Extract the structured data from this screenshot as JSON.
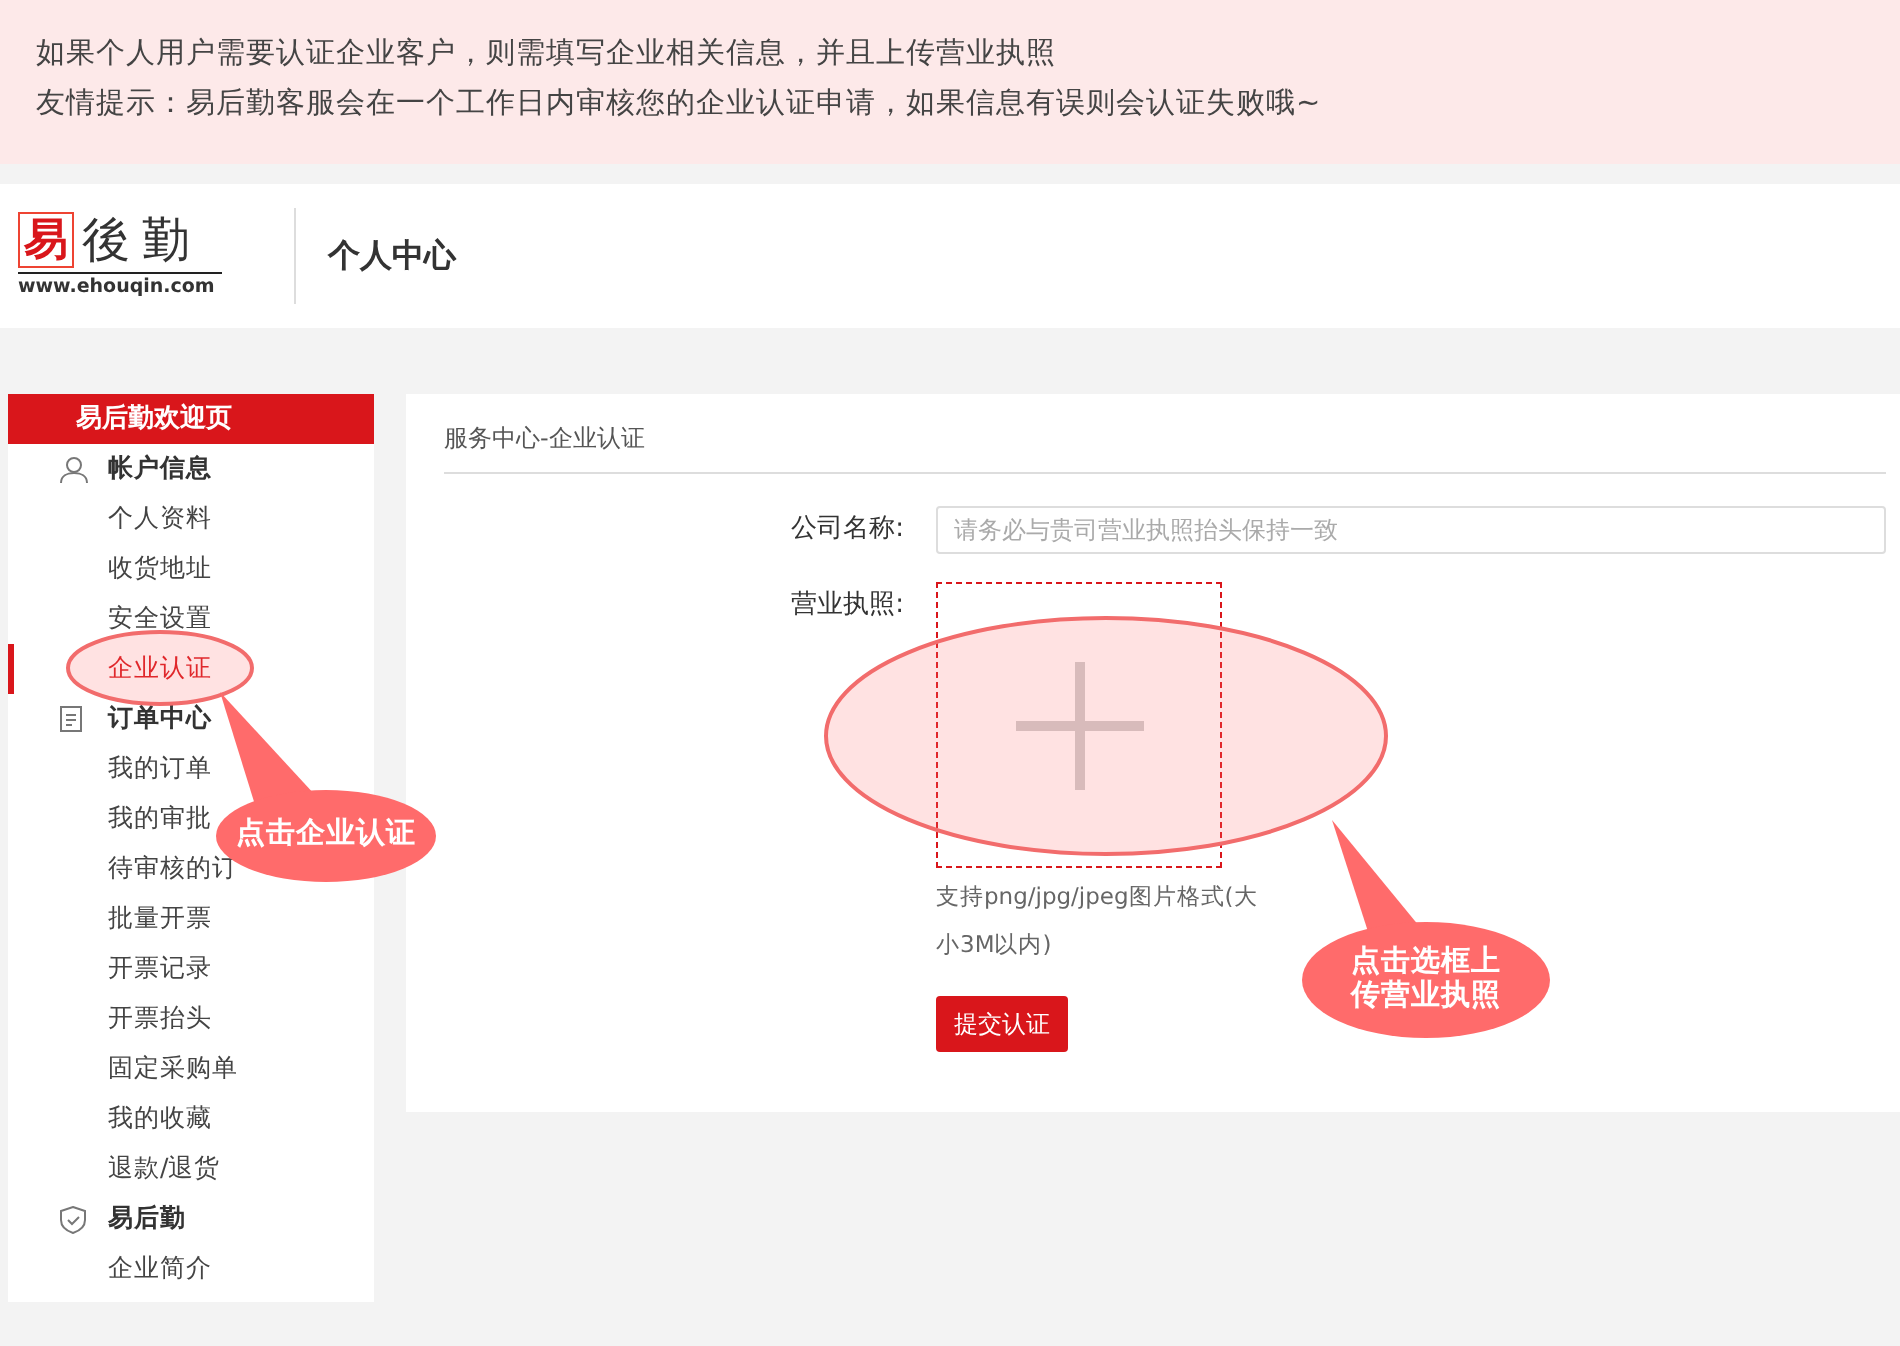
{
  "notice": {
    "lines": [
      "如果个人用户需要认证企业客户，则需填写企业相关信息，并且上传营业执照",
      "友情提示：易后勤客服会在一个工作日内审核您的企业认证申请，如果信息有误则会认证失败哦~"
    ]
  },
  "header": {
    "logo_mark": "易",
    "logo_text": "後勤",
    "logo_url": "www.ehouqin.com",
    "title": "个人中心"
  },
  "sidebar": {
    "banner": "易后勤欢迎页",
    "groups": [
      {
        "title": "帐户信息",
        "kind": "user",
        "items": [
          {
            "label": "个人资料",
            "selected": false
          },
          {
            "label": "收货地址",
            "selected": false
          },
          {
            "label": "安全设置",
            "selected": false
          },
          {
            "label": "企业认证",
            "selected": true
          }
        ]
      },
      {
        "title": "订单中心",
        "kind": "document",
        "items": [
          {
            "label": "我的订单",
            "selected": false
          },
          {
            "label": "我的审批",
            "selected": false
          },
          {
            "label": "待审核的订",
            "selected": false
          },
          {
            "label": "批量开票",
            "selected": false
          },
          {
            "label": "开票记录",
            "selected": false
          },
          {
            "label": "开票抬头",
            "selected": false
          },
          {
            "label": "固定采购单",
            "selected": false
          },
          {
            "label": "我的收藏",
            "selected": false
          },
          {
            "label": "退款/退货",
            "selected": false
          }
        ]
      },
      {
        "title": "易后勤",
        "kind": "shield",
        "items": [
          {
            "label": "企业简介",
            "selected": false
          }
        ]
      }
    ]
  },
  "content": {
    "breadcrumb": "服务中心-企业认证",
    "company_field": {
      "label": "公司名称:",
      "placeholder": "请务必与贵司营业执照抬头保持一致"
    },
    "upload": {
      "label": "营业执照:",
      "hint": "支持png/jpg/jpeg图片格式(大小3M以内)"
    },
    "submit": "提交认证"
  },
  "annotations": [
    {
      "text": "点击企业认证"
    },
    {
      "text": "点击选框上传营业执照"
    }
  ]
}
